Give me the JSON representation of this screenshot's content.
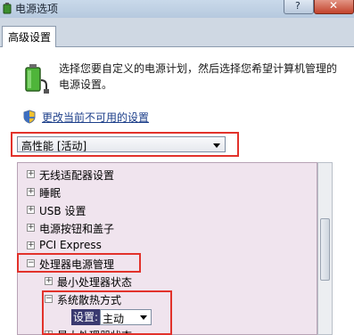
{
  "window": {
    "title": "电源选项",
    "help_label": "?",
    "close_label": "✕"
  },
  "tab": {
    "label": "高级设置"
  },
  "description": "选择您要自定义的电源计划，然后选择您希望计算机管理的电源设置。",
  "link": {
    "label": "更改当前不可用的设置"
  },
  "plan_select": {
    "value": "高性能 [活动]"
  },
  "tree": {
    "items": [
      {
        "toggle": "+",
        "label": "无线适配器设置"
      },
      {
        "toggle": "+",
        "label": "睡眠"
      },
      {
        "toggle": "+",
        "label": "USB 设置"
      },
      {
        "toggle": "+",
        "label": "电源按钮和盖子"
      },
      {
        "toggle": "+",
        "label": "PCI Express"
      },
      {
        "toggle": "−",
        "label": "处理器电源管理"
      },
      {
        "toggle": "+",
        "label": "最小处理器状态"
      },
      {
        "toggle": "−",
        "label": "系统散热方式"
      },
      {
        "toggle": "+",
        "label": "最大处理器状态"
      }
    ],
    "setting": {
      "label": "设置:",
      "value": "主动"
    }
  },
  "colors": {
    "highlight": "#e2322b",
    "tree_bg": "#f0e4ee",
    "link": "#1d3f8a"
  },
  "icons": {
    "title": "power-options-icon",
    "battery": "battery-plug-icon",
    "shield": "uac-shield-icon"
  }
}
